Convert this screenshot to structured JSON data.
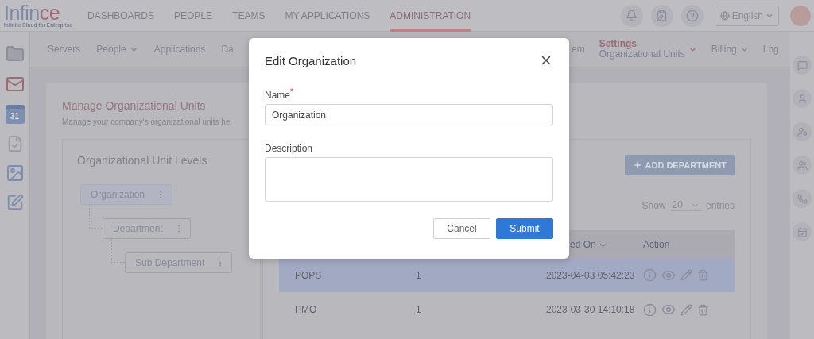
{
  "header": {
    "logo": {
      "word_start": "Infin",
      "word_end": "ce",
      "tagline": "Infinite Cloud for Enterprise"
    },
    "nav": [
      {
        "label": "DASHBOARDS",
        "selected": false
      },
      {
        "label": "PEOPLE",
        "selected": false
      },
      {
        "label": "TEAMS",
        "selected": false
      },
      {
        "label": "MY APPLICATIONS",
        "selected": false
      },
      {
        "label": "ADMINISTRATION",
        "selected": true
      }
    ],
    "language": "English"
  },
  "left_sidebar": {
    "calendar_day": "31"
  },
  "subnav": {
    "left": [
      {
        "label": "Servers",
        "dropdown": false,
        "selected": false
      },
      {
        "label": "People",
        "dropdown": true,
        "selected": false
      },
      {
        "label": "Applications",
        "dropdown": false,
        "selected": false
      },
      {
        "label": "Da",
        "dropdown": false,
        "selected": false
      }
    ],
    "right": [
      {
        "label": "em",
        "dropdown": false,
        "selected": false
      },
      {
        "label": "Settings",
        "sublabel": "Organizational Units",
        "dropdown": true,
        "selected": true
      },
      {
        "label": "Billing",
        "dropdown": true,
        "selected": false
      },
      {
        "label": "Log",
        "dropdown": false,
        "selected": false
      }
    ]
  },
  "page": {
    "title": "Manage Organizational Units",
    "subtitle": "Manage your company's organizational units he"
  },
  "levels": {
    "title": "Organizational Unit Levels",
    "tree": [
      {
        "label": "Organization",
        "selected": true,
        "children": [
          {
            "label": "Department",
            "selected": false,
            "children": [
              {
                "label": "Sub Department",
                "selected": false
              }
            ]
          }
        ]
      }
    ]
  },
  "departments": {
    "add_button": "ADD DEPARTMENT",
    "show": {
      "prefix": "Show",
      "value": "20",
      "suffix": "entries"
    },
    "columns": [
      {
        "label": "ed On",
        "sort_descending": true
      },
      {
        "label": "Action"
      }
    ],
    "rows": [
      {
        "name": "POPS",
        "count": "1",
        "date": "2023-04-03 05:42:23",
        "selected": true
      },
      {
        "name": "PMO",
        "count": "1",
        "date": "2023-03-30 14:10:18",
        "selected": false
      }
    ]
  },
  "modal": {
    "title": "Edit Organization",
    "fields": [
      {
        "kind": "input",
        "label": "Name$^{*}$",
        "value": "Organization"
      },
      {
        "kind": "textarea",
        "label": "Description"
      }
    ],
    "buttons": [
      {
        "label": "Cancel",
        "primary": false
      },
      {
        "label": "Submit",
        "primary": true
      }
    ]
  }
}
